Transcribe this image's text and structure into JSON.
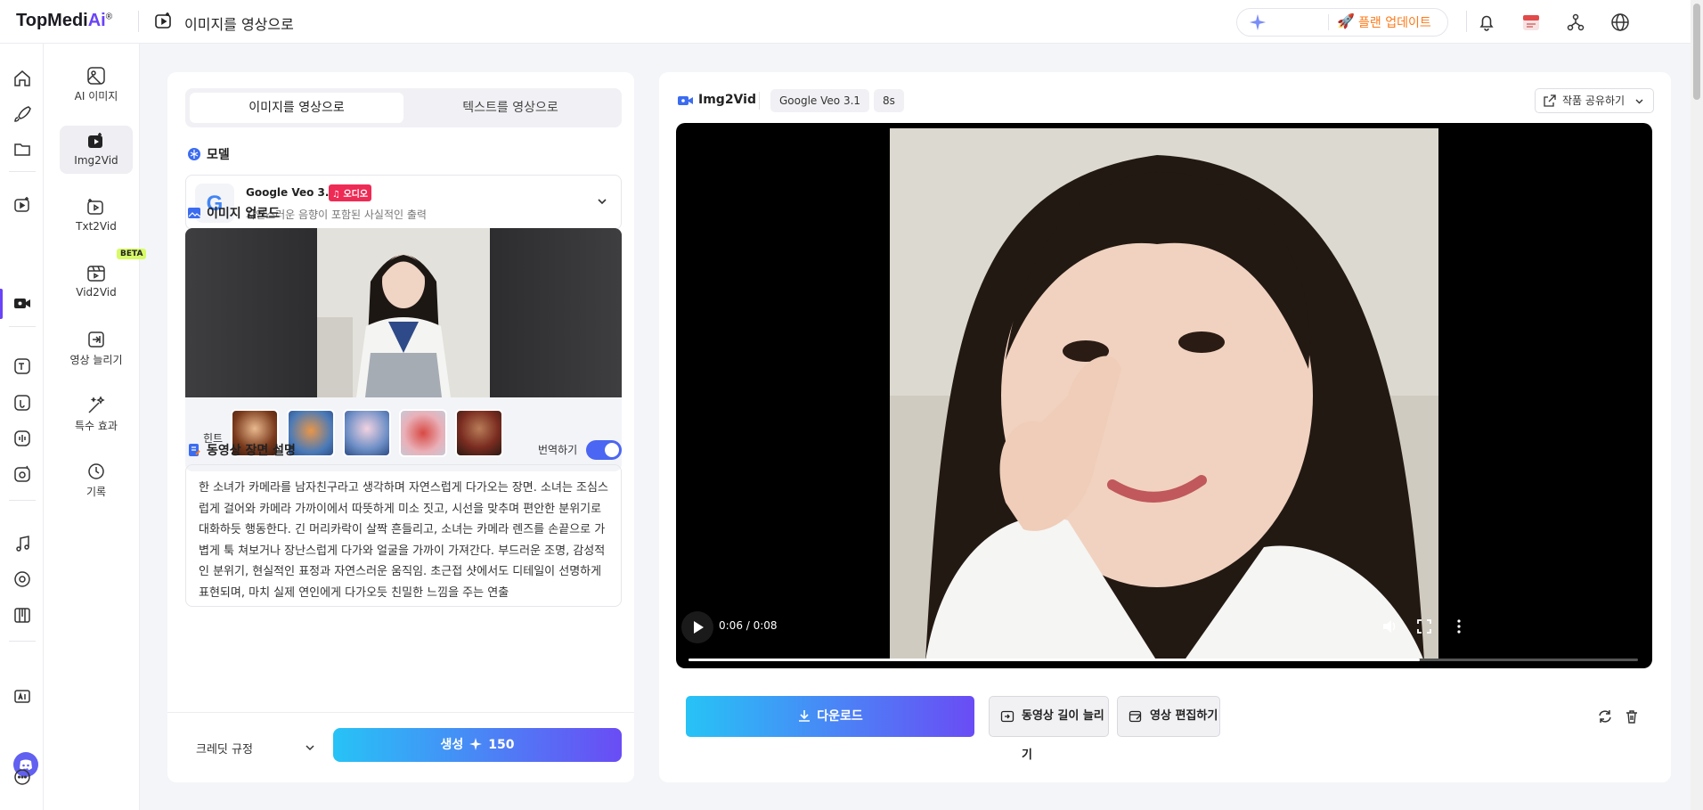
{
  "app": {
    "logo_main": "TopMedi",
    "logo_ai": "Ai",
    "logo_mark": "®",
    "page_title": "이미지를 영상으로",
    "upgrade_label": "플랜 업데이트"
  },
  "subnav": {
    "items": [
      {
        "label": "AI 이미지",
        "icon": "image-icon"
      },
      {
        "label": "Img2Vid",
        "icon": "img2vid-icon",
        "active": true
      },
      {
        "label": "Txt2Vid",
        "icon": "txt2vid-icon"
      },
      {
        "label": "Vid2Vid",
        "icon": "vid2vid-icon"
      },
      {
        "label": "영상 늘리기",
        "icon": "extend-icon"
      },
      {
        "label": "특수 효과",
        "icon": "magic-wand-icon"
      },
      {
        "label": "기록",
        "icon": "history-icon"
      }
    ],
    "beta_badge": "BETA"
  },
  "left_panel": {
    "tabs": [
      "이미지를 영상으로",
      "텍스트를 영상으로"
    ],
    "model_section_title": "모델",
    "model": {
      "name": "Google Veo 3.1",
      "badge": "오디오",
      "description": "자연스러운 음향이 포함된 사실적인 출력"
    },
    "upload_section_title": "이미지 업로드",
    "hints_label": "힌트",
    "description_section_title": "동영상 장면 설명",
    "translate_label": "번역하기",
    "translate_on": true,
    "prompt_text": "한 소녀가 카메라를 남자친구라고 생각하며 자연스럽게 다가오는 장면. 소녀는 조심스럽게 걸어와 카메라 가까이에서 따뜻하게 미소 짓고, 시선을 맞추며 편안한 분위기로 대화하듯 행동한다. 긴 머리카락이 살짝 흔들리고, 소녀는 카메라 렌즈를 손끝으로 가볍게 툭 쳐보거나 장난스럽게 다가와 얼굴을 가까이 가져간다. 부드러운 조명, 감성적인 분위기, 현실적인 표정과 자연스러운 움직임. 초근접 샷에서도 디테일이 선명하게 표현되며, 마치 실제 연인에게 다가오듯 친밀한 느낌을 주는 연출",
    "credit_rule_label": "크레딧 규정",
    "generate_label": "생성",
    "generate_cost": "150"
  },
  "right_panel": {
    "title": "Img2Vid",
    "model_chip": "Google Veo 3.1",
    "duration_chip": "8s",
    "share_label": "작품 공유하기",
    "time_display": "0:06 / 0:08",
    "progress_fraction": 0.77,
    "download_label": "다운로드",
    "extend_label": "동영상 길이 늘리기",
    "edit_label": "영상 편집하기"
  },
  "colors": {
    "accent": "#6a43f7",
    "gradient_start": "#27c3f6",
    "gradient_end": "#6a4cf5",
    "upgrade": "#ff7a1a",
    "audio_badge": "#ee2b55",
    "toggle": "#4b66f2"
  }
}
